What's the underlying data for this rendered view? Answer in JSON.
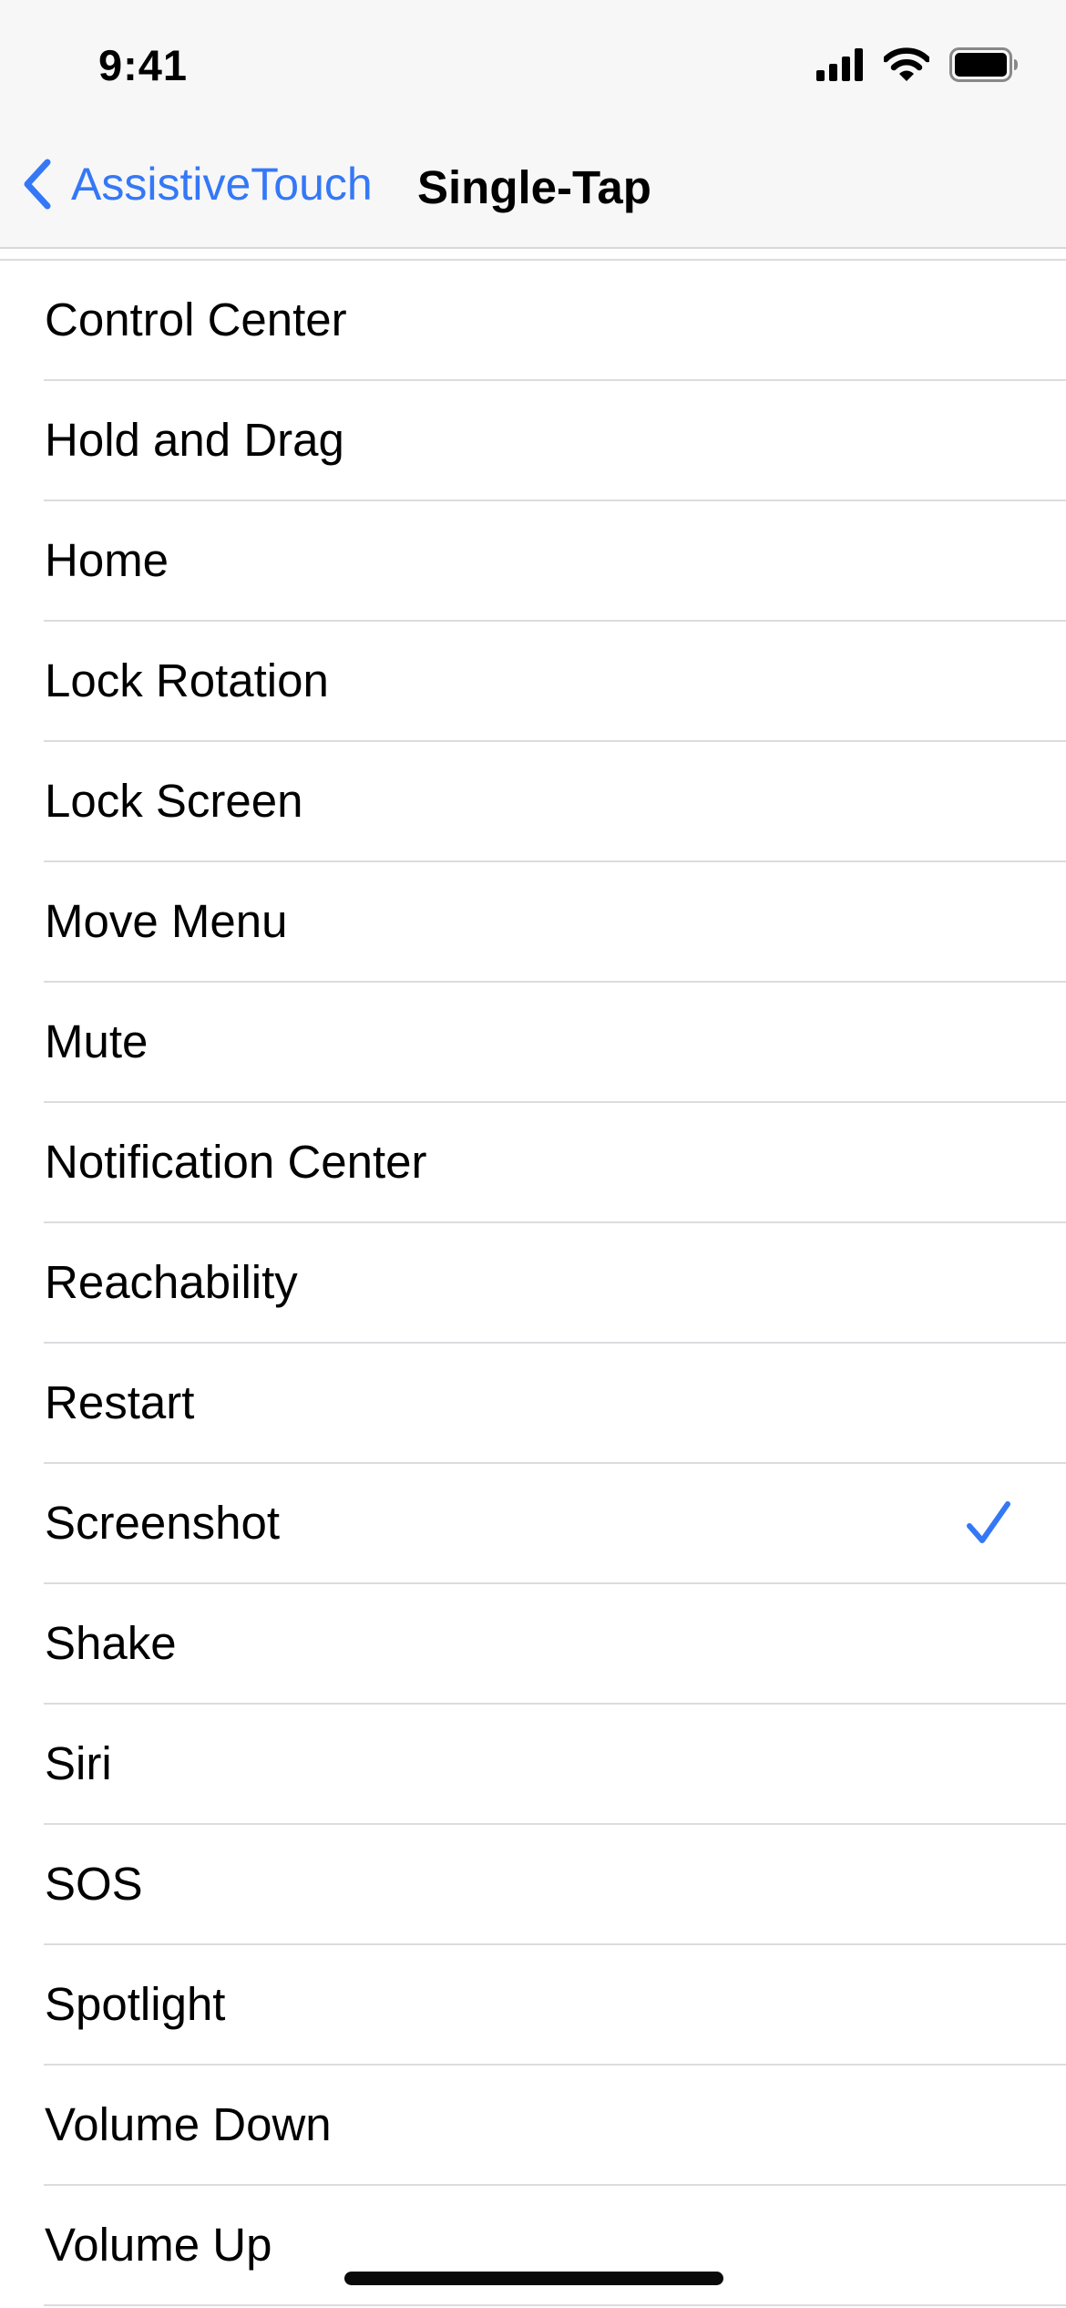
{
  "status_bar": {
    "time": "9:41",
    "icons": [
      "cellular-signal-icon",
      "wifi-icon",
      "battery-icon"
    ]
  },
  "nav": {
    "back_label": "AssistiveTouch",
    "title": "Single-Tap"
  },
  "colors": {
    "accent": "#3478f6",
    "separator": "#dcdcdf",
    "header_bg": "#f7f7f7"
  },
  "items": [
    {
      "label": "Control Center",
      "selected": false
    },
    {
      "label": "Hold and Drag",
      "selected": false
    },
    {
      "label": "Home",
      "selected": false
    },
    {
      "label": "Lock Rotation",
      "selected": false
    },
    {
      "label": "Lock Screen",
      "selected": false
    },
    {
      "label": "Move Menu",
      "selected": false
    },
    {
      "label": "Mute",
      "selected": false
    },
    {
      "label": "Notification Center",
      "selected": false
    },
    {
      "label": "Reachability",
      "selected": false
    },
    {
      "label": "Restart",
      "selected": false
    },
    {
      "label": "Screenshot",
      "selected": true
    },
    {
      "label": "Shake",
      "selected": false
    },
    {
      "label": "Siri",
      "selected": false
    },
    {
      "label": "SOS",
      "selected": false
    },
    {
      "label": "Spotlight",
      "selected": false
    },
    {
      "label": "Volume Down",
      "selected": false
    },
    {
      "label": "Volume Up",
      "selected": false
    }
  ]
}
